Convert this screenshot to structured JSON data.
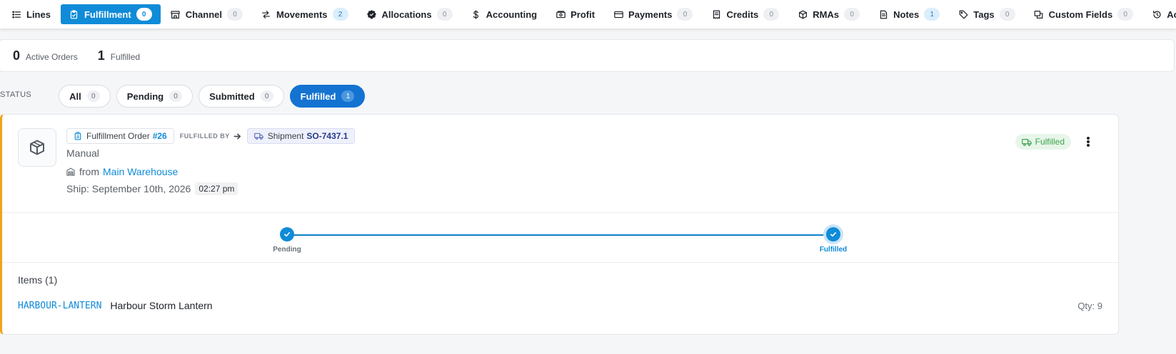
{
  "tabs": [
    {
      "key": "lines",
      "label": "Lines",
      "icon": "list-icon",
      "count": null,
      "active": false
    },
    {
      "key": "fulfillment",
      "label": "Fulfillment",
      "icon": "clipboard-icon",
      "count": "0",
      "active": true
    },
    {
      "key": "channel",
      "label": "Channel",
      "icon": "store-icon",
      "count": "0",
      "active": false
    },
    {
      "key": "movements",
      "label": "Movements",
      "icon": "swap-arrows-icon",
      "count": "2",
      "active": false,
      "highlight": true
    },
    {
      "key": "allocations",
      "label": "Allocations",
      "icon": "badge-check-icon",
      "count": "0",
      "active": false
    },
    {
      "key": "accounting",
      "label": "Accounting",
      "icon": "dollar-icon",
      "count": null,
      "active": false
    },
    {
      "key": "profit",
      "label": "Profit",
      "icon": "cash-icon",
      "count": null,
      "active": false
    },
    {
      "key": "payments",
      "label": "Payments",
      "icon": "credit-card-icon",
      "count": "0",
      "active": false
    },
    {
      "key": "credits",
      "label": "Credits",
      "icon": "receipt-icon",
      "count": "0",
      "active": false
    },
    {
      "key": "rmas",
      "label": "RMAs",
      "icon": "return-box-icon",
      "count": "0",
      "active": false
    },
    {
      "key": "notes",
      "label": "Notes",
      "icon": "note-icon",
      "count": "1",
      "active": false,
      "highlight": true
    },
    {
      "key": "tags",
      "label": "Tags",
      "icon": "tag-icon",
      "count": "0",
      "active": false
    },
    {
      "key": "custom_fields",
      "label": "Custom Fields",
      "icon": "custom-fields-icon",
      "count": "0",
      "active": false
    },
    {
      "key": "activity",
      "label": "Activity",
      "icon": "history-icon",
      "count": null,
      "active": false
    }
  ],
  "summary": {
    "active_orders_count": "0",
    "active_orders_label": "Active Orders",
    "fulfilled_count": "1",
    "fulfilled_label": "Fulfilled"
  },
  "status_filter": {
    "label": "STATUS",
    "options": [
      {
        "label": "All",
        "count": "0",
        "active": false
      },
      {
        "label": "Pending",
        "count": "0",
        "active": false
      },
      {
        "label": "Submitted",
        "count": "0",
        "active": false
      },
      {
        "label": "Fulfilled",
        "count": "1",
        "active": true
      }
    ]
  },
  "order": {
    "fo_label": "Fulfillment Order",
    "fo_number": "#26",
    "fulfilled_by_label": "FULFILLED BY",
    "shipment_label": "Shipment",
    "shipment_number": "SO-7437.1",
    "channel": "Manual",
    "from_label": "from",
    "warehouse": "Main Warehouse",
    "ship_label": "Ship: September 10th, 2026",
    "ship_time": "02:27 pm",
    "status": "Fulfilled",
    "accent_color": "#f0a21a",
    "steps": [
      {
        "label": "Pending",
        "done": true,
        "current": false
      },
      {
        "label": "Fulfilled",
        "done": true,
        "current": true
      }
    ],
    "items_title": "Items (1)",
    "items": [
      {
        "sku": "HARBOUR-LANTERN",
        "name": "Harbour Storm Lantern",
        "qty": "Qty: 9"
      }
    ]
  },
  "colors": {
    "primary": "#0f8bd8",
    "active_pill": "#1473d1",
    "success": "#3aa44a"
  }
}
